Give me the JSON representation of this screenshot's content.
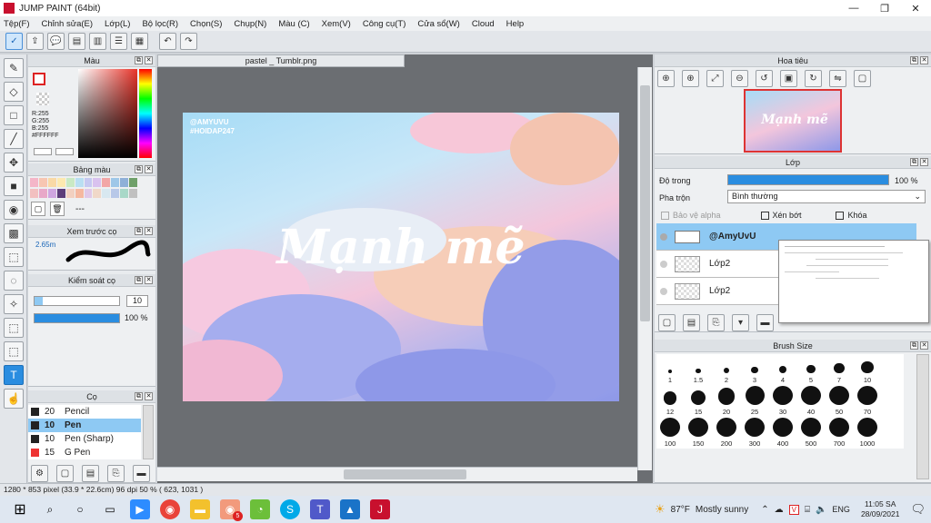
{
  "window": {
    "title": "JUMP PAINT (64bit)",
    "min": "—",
    "max": "❐",
    "close": "✕"
  },
  "menu": [
    "Tệp(F)",
    "Chỉnh sửa(E)",
    "Lớp(L)",
    "Bộ lọc(R)",
    "Chọn(S)",
    "Chụp(N)",
    "Màu (C)",
    "Xem(V)",
    "Công cụ(T)",
    "Cửa sổ(W)",
    "Cloud",
    "Help"
  ],
  "color_panel": {
    "title": "Màu",
    "r": "R:255",
    "g": "G:255",
    "b": "B:255",
    "hex": "#FFFFFF"
  },
  "palette_panel": {
    "title": "Bảng màu",
    "dash": "---"
  },
  "brush_preview": {
    "title": "Xem trước cọ",
    "size": "2.65m"
  },
  "brush_control": {
    "title": "Kiểm soát cọ",
    "size_value": "10",
    "opacity_value": "100 %",
    "size_fraction": 0.1,
    "opacity_fraction": 1.0
  },
  "brush_list": {
    "title": "Cọ",
    "items": [
      {
        "size": "20",
        "name": "Pencil"
      },
      {
        "size": "10",
        "name": "Pen"
      },
      {
        "size": "10",
        "name": "Pen (Sharp)"
      },
      {
        "size": "15",
        "name": "G Pen"
      }
    ]
  },
  "document": {
    "tab": "pastel _ Tumblr.png",
    "watermark1": "@AMYUVU",
    "watermark2": "#HOIDAP247",
    "art_text": "Mạnh mẽ"
  },
  "navigator": {
    "title": "Hoa tiêu"
  },
  "layer_panel": {
    "title": "Lớp",
    "opacity_label": "Độ trong",
    "opacity_value": "100 %",
    "blend_label": "Pha trộn",
    "blend_value": "Bình thường",
    "protect_alpha": "Bảo vệ alpha",
    "clipping": "Xén bớt",
    "lock": "Khóa",
    "layers": [
      "@AmyUvU",
      "Lớp2",
      "Lớp2"
    ]
  },
  "brush_size": {
    "title": "Brush Size",
    "sizes": [
      "1",
      "1.5",
      "2",
      "3",
      "4",
      "5",
      "7",
      "10",
      "12",
      "15",
      "20",
      "25",
      "30",
      "40",
      "50",
      "70",
      "100",
      "150",
      "200",
      "300",
      "400",
      "500",
      "700",
      "1000"
    ]
  },
  "status": "1280 * 853 pixel   (33.9 * 22.6cm)   96 dpi   50 %   ( 623, 1031 )",
  "taskbar": {
    "weather_temp": "87°F",
    "weather_text": "Mostly sunny",
    "lang": "ENG",
    "time": "11:05 SA",
    "date": "28/09/2021",
    "badge": "5"
  },
  "colors": {
    "accent": "#2a8de0",
    "canvas_bg": "#6b6e72"
  }
}
